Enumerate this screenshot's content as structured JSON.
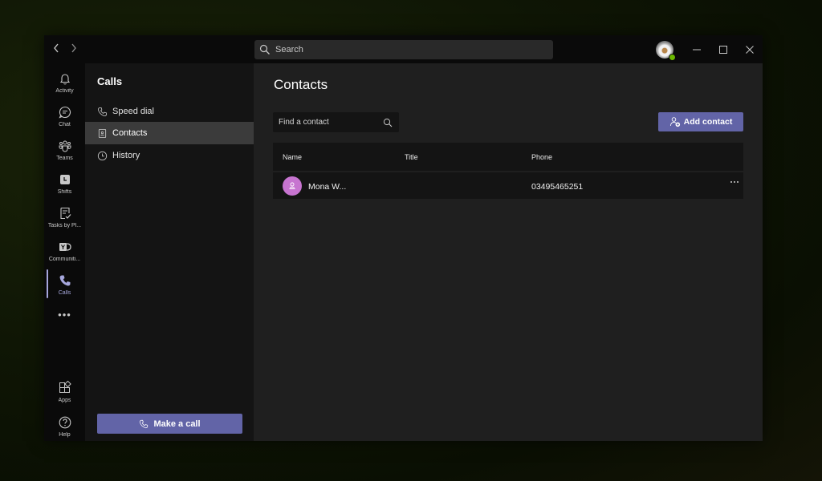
{
  "titlebar": {
    "back_icon": "chevron-left-icon",
    "forward_icon": "chevron-right-icon",
    "search_placeholder": "Search",
    "profile_status": "available",
    "colors": {
      "presence": "#6bb700"
    }
  },
  "rail": {
    "items": [
      {
        "label": "Activity",
        "icon": "bell-icon"
      },
      {
        "label": "Chat",
        "icon": "chat-icon"
      },
      {
        "label": "Teams",
        "icon": "teams-icon"
      },
      {
        "label": "Shifts",
        "icon": "shifts-icon"
      },
      {
        "label": "Tasks by Pl...",
        "icon": "tasks-icon"
      },
      {
        "label": "Communiti...",
        "icon": "yammer-icon"
      },
      {
        "label": "Calls",
        "icon": "phone-icon",
        "active": true
      }
    ],
    "more_label": "•••",
    "bottom": [
      {
        "label": "Apps",
        "icon": "apps-icon"
      },
      {
        "label": "Help",
        "icon": "help-icon"
      }
    ],
    "colors": {
      "active": "#a6a7dc"
    }
  },
  "calls_panel": {
    "title": "Calls",
    "items": [
      {
        "label": "Speed dial",
        "icon": "phone-icon"
      },
      {
        "label": "Contacts",
        "icon": "contact-card-icon",
        "active": true
      },
      {
        "label": "History",
        "icon": "clock-icon"
      }
    ],
    "make_call_label": "Make a call"
  },
  "main": {
    "title": "Contacts",
    "find_placeholder": "Find a contact",
    "add_contact_label": "Add contact",
    "table": {
      "columns": [
        "Name",
        "Title",
        "Phone"
      ],
      "rows": [
        {
          "name": "Mona W...",
          "title": "",
          "phone": "03495465251",
          "avatar_color": "#c774d0"
        }
      ]
    },
    "colors": {
      "accent": "#6264a7"
    }
  }
}
